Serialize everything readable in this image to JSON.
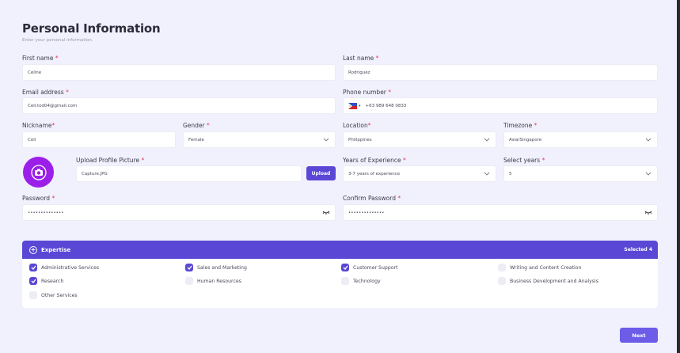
{
  "header": {
    "title": "Personal Information",
    "subtitle": "Enter your personal information."
  },
  "form": {
    "first_name": {
      "label": "First name",
      "value": "Celine"
    },
    "last_name": {
      "label": "Last name",
      "value": "Rodriguez"
    },
    "email": {
      "label": "Email address",
      "value": "Celi.tod04@gmail.com"
    },
    "phone": {
      "label": "Phone number",
      "value": "+63 989 648 0833"
    },
    "nickname": {
      "label": "Nickname",
      "value": "Celi"
    },
    "gender": {
      "label": "Gender",
      "value": "Female"
    },
    "location": {
      "label": "Location",
      "value": "Philippines"
    },
    "timezone": {
      "label": "Timezone",
      "value": "Asia/Singapore"
    },
    "profile_picture": {
      "label": "Upload Profile Picture",
      "value": "Capture.JPG",
      "button": "Upload"
    },
    "experience": {
      "label": "Years of Experience",
      "value": "3-7 years of experience"
    },
    "select_years": {
      "label": "Select years",
      "value": "5"
    },
    "password": {
      "label": "Password",
      "value": "••••••••••••••"
    },
    "confirm_password": {
      "label": "Confirm Password",
      "value": "••••••••••••••"
    },
    "required_mark": "*"
  },
  "expertise": {
    "title": "Expertise",
    "selected_text": "Selected 4",
    "options": [
      {
        "label": "Administrative Services",
        "checked": true
      },
      {
        "label": "Sales and Marketing",
        "checked": true
      },
      {
        "label": "Customer Support",
        "checked": true
      },
      {
        "label": "Writing and Content Creation",
        "checked": false
      },
      {
        "label": "Research",
        "checked": true
      },
      {
        "label": "Human Resources",
        "checked": false
      },
      {
        "label": "Technology",
        "checked": false
      },
      {
        "label": "Business Development and Analysis",
        "checked": false
      },
      {
        "label": "Other Services",
        "checked": false
      }
    ]
  },
  "footer": {
    "next_label": "Next"
  },
  "colors": {
    "accent": "#5a47d5",
    "avatar": "#9b1fe8",
    "required": "#e0405a",
    "background": "#f1f0fd"
  }
}
